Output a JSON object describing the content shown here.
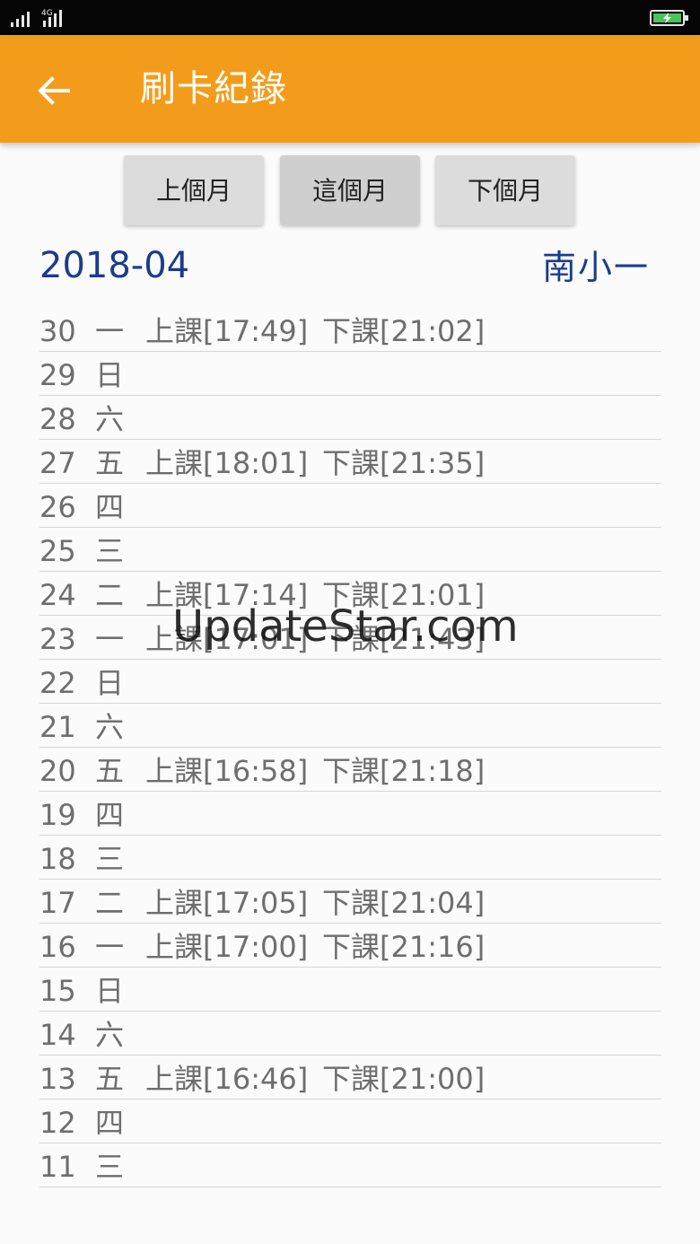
{
  "status_bar": {
    "network_label": "4G",
    "signal_icon": "signal-bars-icon",
    "battery_icon": "battery-charging-icon"
  },
  "header": {
    "back_icon": "arrow-left-icon",
    "title": "刷卡紀錄",
    "background_color": "#f39c1c"
  },
  "month_nav": {
    "prev": "上個月",
    "current": "這個月",
    "next": "下個月"
  },
  "summary": {
    "month": "2018-04",
    "student": "南小一",
    "accent_color": "#1b3c8c"
  },
  "records": [
    {
      "day": "30",
      "weekday": "一",
      "in": "上課[17:49]",
      "out": "下課[21:02]"
    },
    {
      "day": "29",
      "weekday": "日",
      "in": "",
      "out": ""
    },
    {
      "day": "28",
      "weekday": "六",
      "in": "",
      "out": ""
    },
    {
      "day": "27",
      "weekday": "五",
      "in": "上課[18:01]",
      "out": "下課[21:35]"
    },
    {
      "day": "26",
      "weekday": "四",
      "in": "",
      "out": ""
    },
    {
      "day": "25",
      "weekday": "三",
      "in": "",
      "out": ""
    },
    {
      "day": "24",
      "weekday": "二",
      "in": "上課[17:14]",
      "out": "下課[21:01]"
    },
    {
      "day": "23",
      "weekday": "一",
      "in": "上課[17:01]",
      "out": "下課[21:43]"
    },
    {
      "day": "22",
      "weekday": "日",
      "in": "",
      "out": ""
    },
    {
      "day": "21",
      "weekday": "六",
      "in": "",
      "out": ""
    },
    {
      "day": "20",
      "weekday": "五",
      "in": "上課[16:58]",
      "out": "下課[21:18]"
    },
    {
      "day": "19",
      "weekday": "四",
      "in": "",
      "out": ""
    },
    {
      "day": "18",
      "weekday": "三",
      "in": "",
      "out": ""
    },
    {
      "day": "17",
      "weekday": "二",
      "in": "上課[17:05]",
      "out": "下課[21:04]"
    },
    {
      "day": "16",
      "weekday": "一",
      "in": "上課[17:00]",
      "out": "下課[21:16]"
    },
    {
      "day": "15",
      "weekday": "日",
      "in": "",
      "out": ""
    },
    {
      "day": "14",
      "weekday": "六",
      "in": "",
      "out": ""
    },
    {
      "day": "13",
      "weekday": "五",
      "in": "上課[16:46]",
      "out": "下課[21:00]"
    },
    {
      "day": "12",
      "weekday": "四",
      "in": "",
      "out": ""
    },
    {
      "day": "11",
      "weekday": "三",
      "in": "",
      "out": ""
    }
  ],
  "watermark": "UpdateStar.com"
}
